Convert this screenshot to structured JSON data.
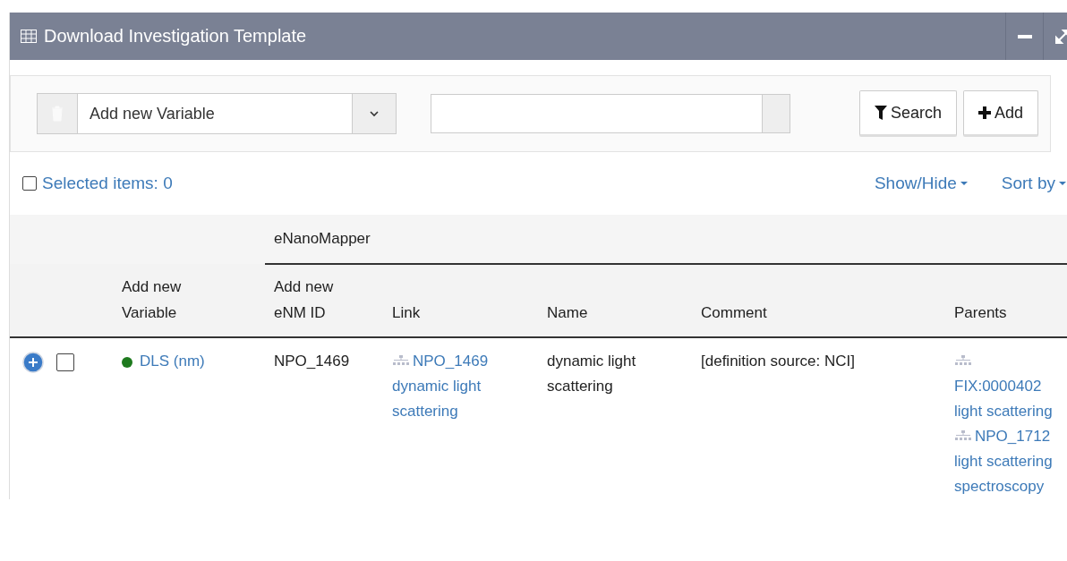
{
  "window": {
    "title": "Download Investigation Template"
  },
  "toolbar": {
    "variable_select": {
      "value": "Add new Variable"
    },
    "search_button": "Search",
    "add_button": "Add"
  },
  "selection": {
    "label": "Selected items: 0",
    "checked": false
  },
  "menus": [
    "Show/Hide",
    "Sort by"
  ],
  "table": {
    "group_header": "eNanoMapper",
    "columns": [
      "Add new Variable",
      "Add new eNM ID",
      "Link",
      "Name",
      "Comment",
      "Parents"
    ],
    "rows": [
      {
        "checked": false,
        "variable": {
          "text": "DLS (nm)",
          "color": "#1e7a1e"
        },
        "enm_id": "NPO_1469",
        "link": "NPO_1469 dynamic light scattering",
        "name": "dynamic light scattering",
        "comment": "[definition source: NCI]",
        "parents": [
          "FIX:0000402 light scattering",
          "NPO_1712 light scattering spectroscopy"
        ]
      }
    ]
  }
}
